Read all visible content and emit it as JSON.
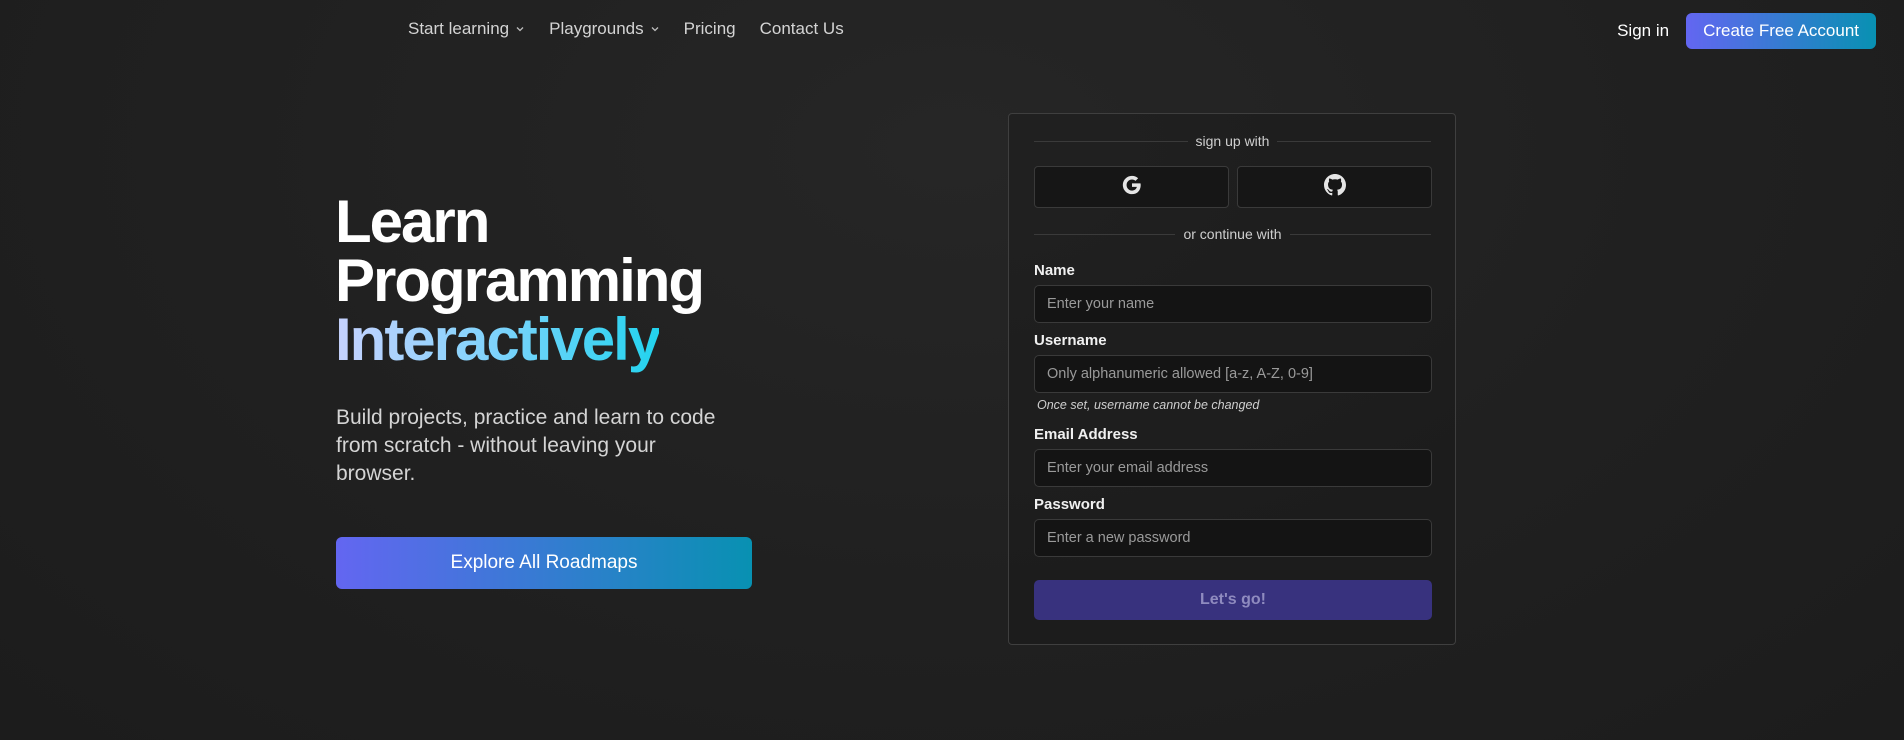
{
  "nav": {
    "links": [
      {
        "label": "Start learning",
        "has_dropdown": true
      },
      {
        "label": "Playgrounds",
        "has_dropdown": true
      },
      {
        "label": "Pricing"
      },
      {
        "label": "Contact Us"
      }
    ],
    "sign_in": "Sign in",
    "create_account": "Create Free Account"
  },
  "hero": {
    "title_line1": "Learn",
    "title_line2": "Programming",
    "title_line3": "Interactively",
    "subtitle": "Build projects, practice and learn to code from scratch - without leaving your browser.",
    "explore_button": "Explore All Roadmaps"
  },
  "form": {
    "sign_up_with": "sign up with",
    "or_continue_with": "or continue with",
    "oauth": [
      {
        "icon": "google-icon"
      },
      {
        "icon": "github-icon"
      }
    ],
    "name_label": "Name",
    "name_placeholder": "Enter your name",
    "username_label": "Username",
    "username_placeholder": "Only alphanumeric allowed [a-z, A-Z, 0-9]",
    "username_hint": "Once set, username cannot be changed",
    "email_label": "Email Address",
    "email_placeholder": "Enter your email address",
    "password_label": "Password",
    "password_placeholder": "Enter a new password",
    "submit": "Let's go!"
  },
  "colors": {
    "accent_start": "#6366f1",
    "accent_end": "#0891b2",
    "background": "#202020",
    "submit_bg": "#38327e"
  }
}
